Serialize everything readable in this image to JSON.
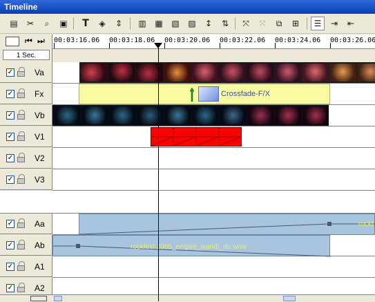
{
  "window": {
    "title": "Timeline"
  },
  "ruler": {
    "timecodes": [
      "00:03:16.06",
      "00:03:18.06",
      "00:03:20.06",
      "00:03:22.06",
      "00:03:24.06",
      "00:03:26.06"
    ],
    "scale_label": "1 Sec."
  },
  "tracks": {
    "video": [
      {
        "name": "Va",
        "checked": true
      },
      {
        "name": "Fx",
        "checked": true
      },
      {
        "name": "Vb",
        "checked": true
      },
      {
        "name": "V1",
        "checked": true
      },
      {
        "name": "V2",
        "checked": true
      },
      {
        "name": "V3",
        "checked": true
      }
    ],
    "audio": [
      {
        "name": "Aa",
        "checked": true
      },
      {
        "name": "Ab",
        "checked": true
      },
      {
        "name": "A1",
        "checked": true
      },
      {
        "name": "A2",
        "checked": true
      }
    ]
  },
  "clips": {
    "transition_label": "Crossfade-F/X",
    "audio_aa_label": "rockf",
    "audio_ab_label": "rockfest 2005_empire_wandt_du.wmv"
  },
  "colors": {
    "fx_track": "#fafaa0",
    "v1_clip": "#ff0000",
    "audio_clip": "#a8c4df",
    "audio_text": "#f0f04a",
    "title_bar": "#0a3fb8"
  },
  "toolbar": {
    "icons": [
      "storyboard-icon",
      "razor-icon",
      "zoom-icon",
      "clip-icon",
      "text-icon",
      "effects-icon",
      "split-icon",
      "track-view-icon",
      "track-view2-icon",
      "snapshot-icon",
      "marker-icon",
      "cursor-tool-icon",
      "disable-icon",
      "disabled-icon",
      "group-icon",
      "ungroup-icon",
      "list-icon",
      "indent-icon",
      "outdent-icon"
    ]
  }
}
